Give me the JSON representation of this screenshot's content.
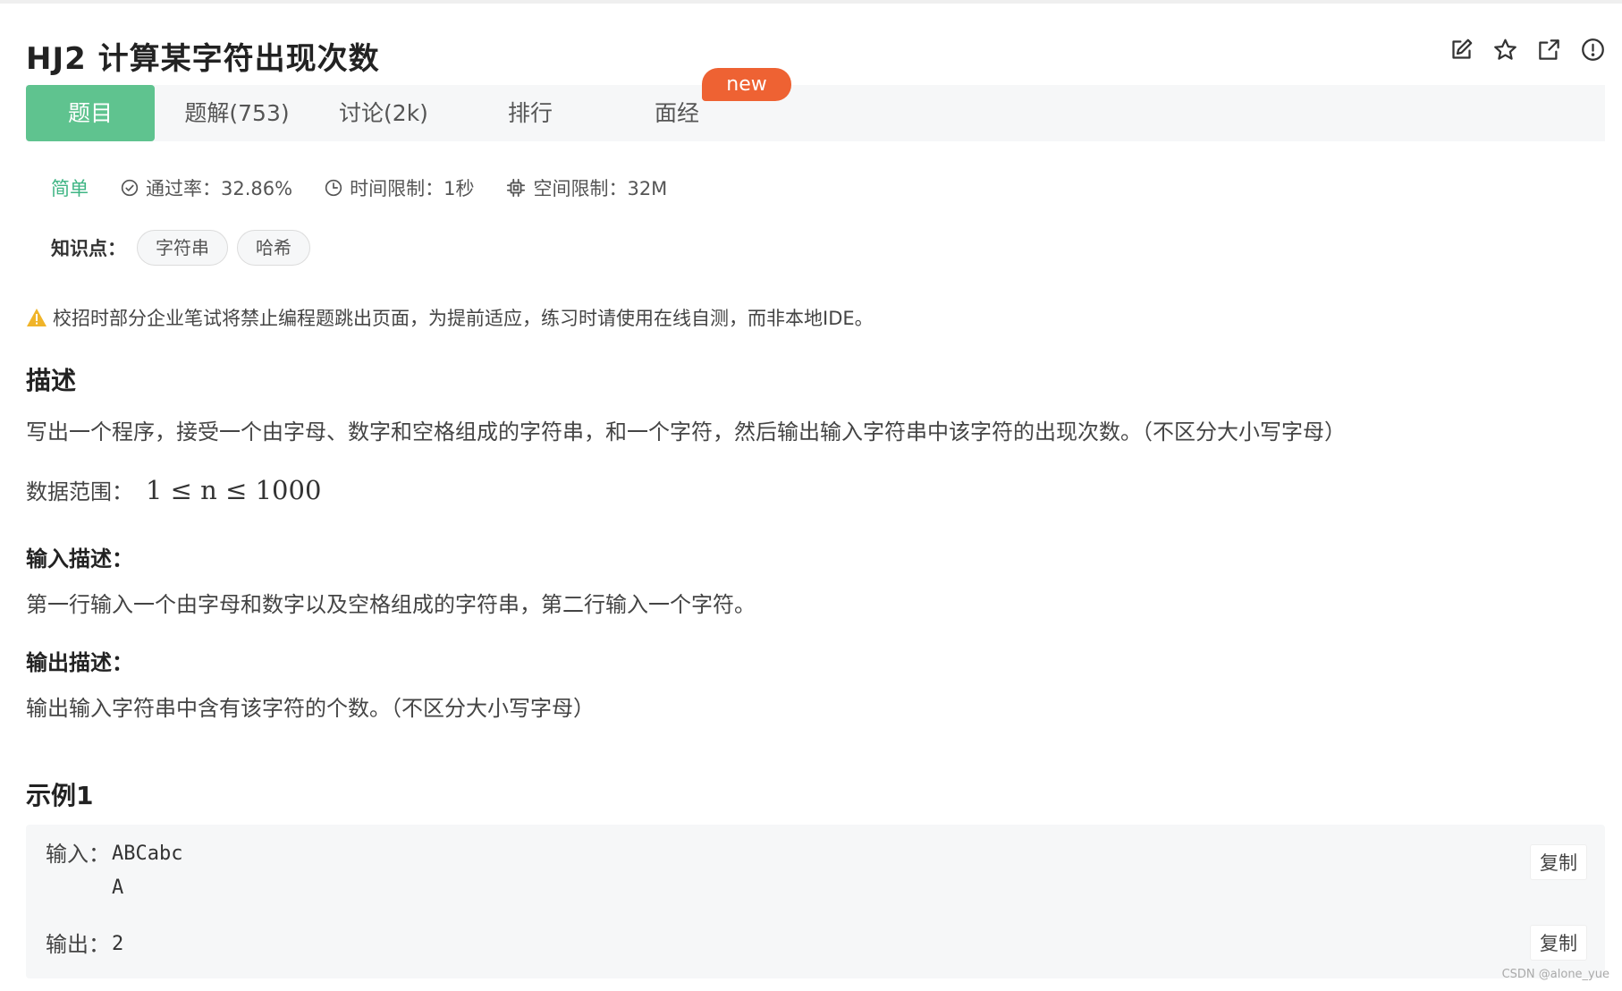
{
  "header": {
    "title": "HJ2  计算某字符出现次数",
    "icons": [
      "edit-icon",
      "star-icon",
      "share-icon",
      "report-icon"
    ]
  },
  "tabs": [
    {
      "label": "题目",
      "active": true
    },
    {
      "label": "题解(753)",
      "active": false
    },
    {
      "label": "讨论(2k)",
      "active": false
    },
    {
      "label": "排行",
      "active": false
    },
    {
      "label": "面经",
      "active": false
    }
  ],
  "badge": "new",
  "meta": {
    "difficulty": "简单",
    "pass_rate": "通过率：32.86%",
    "time_limit": "时间限制：1秒",
    "space_limit": "空间限制：32M"
  },
  "knowledge": {
    "label": "知识点：",
    "tags": [
      "字符串",
      "哈希"
    ]
  },
  "warning": "校招时部分企业笔试将禁止编程题跳出页面，为提前适应，练习时请使用在线自测，而非本地IDE。",
  "description": {
    "heading": "描述",
    "text": "写出一个程序，接受一个由字母、数字和空格组成的字符串，和一个字符，然后输出输入字符串中该字符的出现次数。（不区分大小写字母）",
    "range_label": "数据范围：",
    "range_math": "1 ≤ n ≤ 1000"
  },
  "input_desc": {
    "heading": "输入描述：",
    "text": "第一行输入一个由字母和数字以及空格组成的字符串，第二行输入一个字符。"
  },
  "output_desc": {
    "heading": "输出描述：",
    "text": "输出输入字符串中含有该字符的个数。（不区分大小写字母）"
  },
  "example": {
    "heading": "示例1",
    "input_label": "输入：",
    "input_line1": "ABCabc",
    "input_line2": "A",
    "output_label": "输出：",
    "output_value": "2",
    "copy_label": "复制"
  },
  "watermark": "CSDN @alone_yue",
  "colors": {
    "accent": "#5fc38f",
    "difficulty": "#3fb584",
    "badge": "#ee6233",
    "warning": "#f0b429"
  }
}
